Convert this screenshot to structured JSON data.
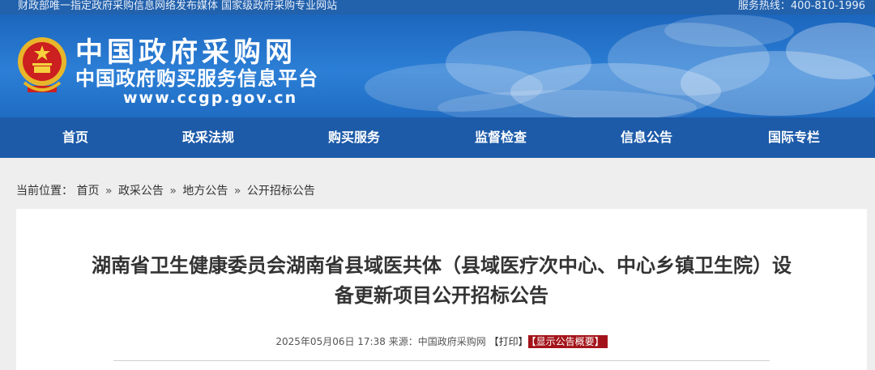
{
  "topbar": {
    "left_text": "财政部唯一指定政府采购信息网络发布媒体 国家级政府采购专业网站",
    "right_text": "服务热线：400-810-1996"
  },
  "header": {
    "site_name": "中国政府采购网",
    "subtitle": "中国政府购买服务信息平台",
    "url": "www.ccgp.gov.cn"
  },
  "nav": {
    "items": [
      "首页",
      "政采法规",
      "购买服务",
      "监督检查",
      "信息公告",
      "国际专栏"
    ]
  },
  "breadcrumb": {
    "prefix": "当前位置：",
    "items": [
      "首页",
      "政采公告",
      "地方公告",
      "公开招标公告"
    ],
    "separator": "»"
  },
  "article": {
    "title_line1": "湖南省卫生健康委员会湖南省县域医共体（县域医疗次中心、中心乡镇卫生院）设",
    "title_line2": "备更新项目公开招标公告",
    "datetime": "2025年05月06日 17:38",
    "source_label": "来源：",
    "source": "中国政府采购网",
    "print_label": "【打印】",
    "summary_label": "【显示公告概要】"
  },
  "colors": {
    "topbar": "#2261ac",
    "nav": "#1d5ba9",
    "header": "#2c7fd6",
    "summary_badge": "#a3141a"
  }
}
